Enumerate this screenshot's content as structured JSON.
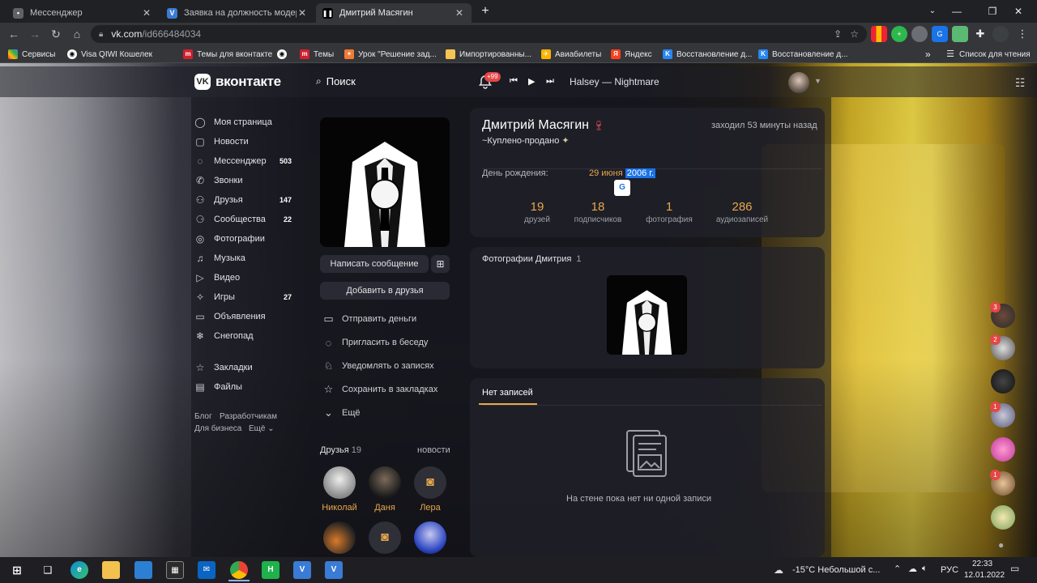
{
  "browser": {
    "tabs": [
      {
        "title": "Мессенджер"
      },
      {
        "title": "Заявка на должность модерато"
      },
      {
        "title": "Дмитрий Масягин"
      }
    ],
    "new_tab": "+",
    "url_host": "vk.com",
    "url_path": "/id666484034",
    "bookmarks": [
      "Сервисы",
      "Visa QIWI Кошелек",
      "Темы для вконтакте",
      "Темы",
      "Урок \"Решение зад...",
      "Импортированны...",
      "Авиабилеты",
      "Яндекс",
      "Восстановление д...",
      "Восстановление д..."
    ],
    "bookmarks_more": "»",
    "reading_list": "Список для чтения"
  },
  "vk": {
    "logo_text": "вконтакте",
    "search_label": "Поиск",
    "notif_count": "+99",
    "track": "Halsey — Nightmare",
    "menu": [
      {
        "label": "Моя страница",
        "count": ""
      },
      {
        "label": "Новости",
        "count": ""
      },
      {
        "label": "Мессенджер",
        "count": "503"
      },
      {
        "label": "Звонки",
        "count": ""
      },
      {
        "label": "Друзья",
        "count": "147"
      },
      {
        "label": "Сообщества",
        "count": "22"
      },
      {
        "label": "Фотографии",
        "count": ""
      },
      {
        "label": "Музыка",
        "count": ""
      },
      {
        "label": "Видео",
        "count": ""
      },
      {
        "label": "Игры",
        "count": "27"
      },
      {
        "label": "Объявления",
        "count": ""
      },
      {
        "label": "Снегопад",
        "count": ""
      }
    ],
    "menu2": [
      {
        "label": "Закладки"
      },
      {
        "label": "Файлы"
      }
    ],
    "footer": {
      "blog": "Блог",
      "dev": "Разработчикам",
      "biz": "Для бизнеса",
      "more": "Ещё"
    }
  },
  "profile": {
    "name": "Дмитрий Масягин",
    "status": "~Куплено-продано",
    "last_seen": "заходил 53 минуты назад",
    "birthday_label": "День рождения:",
    "birthday_date": "29 июня",
    "birthday_year": "2006 г.",
    "stats": [
      {
        "num": "19",
        "label": "друзей"
      },
      {
        "num": "18",
        "label": "подписчиков"
      },
      {
        "num": "1",
        "label": "фотография"
      },
      {
        "num": "286",
        "label": "аудиозаписей"
      }
    ],
    "btn_message": "Написать сообщение",
    "btn_add": "Добавить в друзья",
    "actions": [
      "Отправить деньги",
      "Пригласить в беседу",
      "Уведомлять о записях",
      "Сохранить в закладках",
      "Ещё"
    ],
    "photos_title": "Фотографии Дмитрия",
    "photos_count": "1",
    "wall_tab": "Нет записей",
    "wall_empty": "На стене пока нет ни одной записи",
    "friends_title": "Друзья",
    "friends_count": "19",
    "friends_news": "новости",
    "friends": [
      {
        "name": "Николай"
      },
      {
        "name": "Даня"
      },
      {
        "name": "Лера"
      }
    ]
  },
  "side_badges": [
    "3",
    "2",
    "1",
    "1"
  ],
  "taskbar": {
    "weather": "-15°C  Небольшой с...",
    "lang": "РУС",
    "time": "22:33",
    "date": "12.01.2022"
  }
}
